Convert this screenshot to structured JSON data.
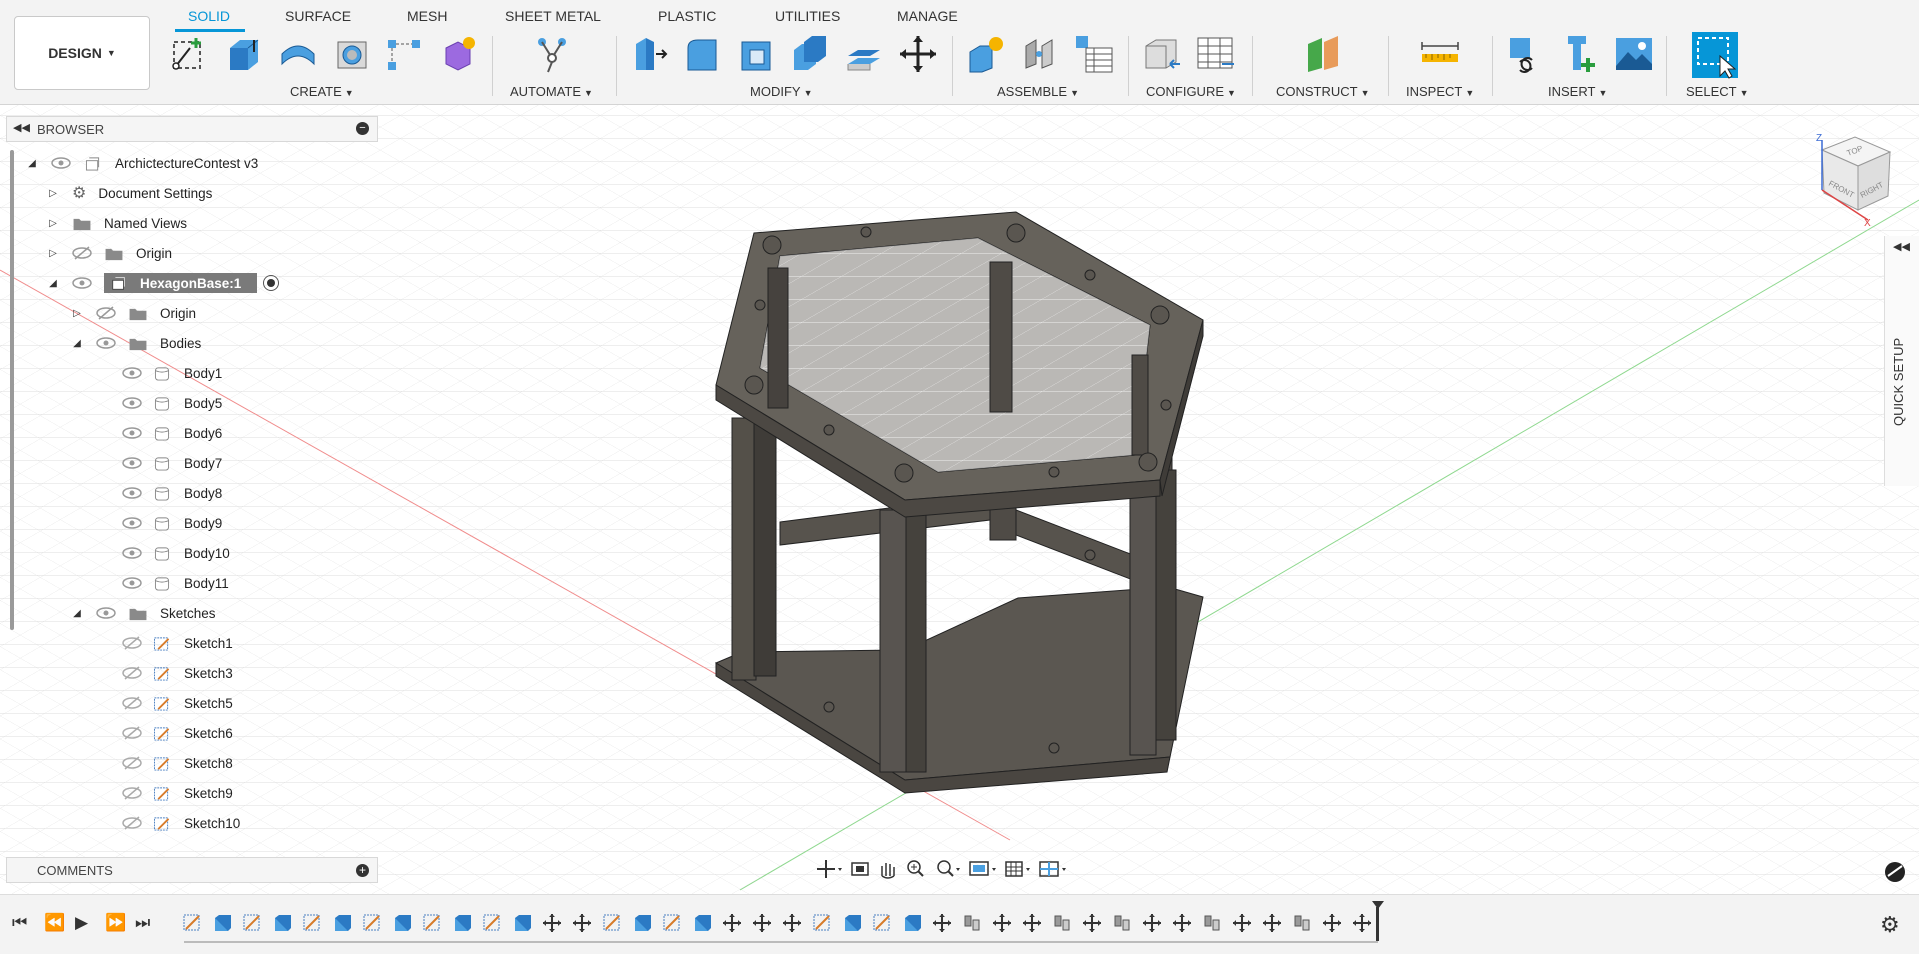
{
  "toolbar": {
    "workspace_label": "DESIGN",
    "tabs": [
      {
        "label": "SOLID",
        "active": true
      },
      {
        "label": "SURFACE"
      },
      {
        "label": "MESH"
      },
      {
        "label": "SHEET METAL"
      },
      {
        "label": "PLASTIC"
      },
      {
        "label": "UTILITIES"
      },
      {
        "label": "MANAGE"
      }
    ],
    "groups": {
      "create": "CREATE",
      "automate": "AUTOMATE",
      "modify": "MODIFY",
      "assemble": "ASSEMBLE",
      "configure": "CONFIGURE",
      "construct": "CONSTRUCT",
      "inspect": "INSPECT",
      "insert": "INSERT",
      "select": "SELECT"
    },
    "accent_color": "#0696d7"
  },
  "browser": {
    "title": "BROWSER",
    "root": "ArchictectureContest v3",
    "document_settings": "Document Settings",
    "named_views": "Named Views",
    "origin": "Origin",
    "component": "HexagonBase:1",
    "component_origin": "Origin",
    "bodies_folder": "Bodies",
    "bodies": [
      "Body1",
      "Body5",
      "Body6",
      "Body7",
      "Body8",
      "Body9",
      "Body10",
      "Body11"
    ],
    "sketches_folder": "Sketches",
    "sketches": [
      "Sketch1",
      "Sketch3",
      "Sketch5",
      "Sketch6",
      "Sketch8",
      "Sketch9",
      "Sketch10"
    ]
  },
  "comments": {
    "title": "COMMENTS"
  },
  "quick_setup": {
    "label": "QUICK SETUP"
  },
  "viewcube": {
    "top": "TOP",
    "front": "FRONT",
    "right": "RIGHT",
    "z": "Z",
    "x": "X"
  }
}
